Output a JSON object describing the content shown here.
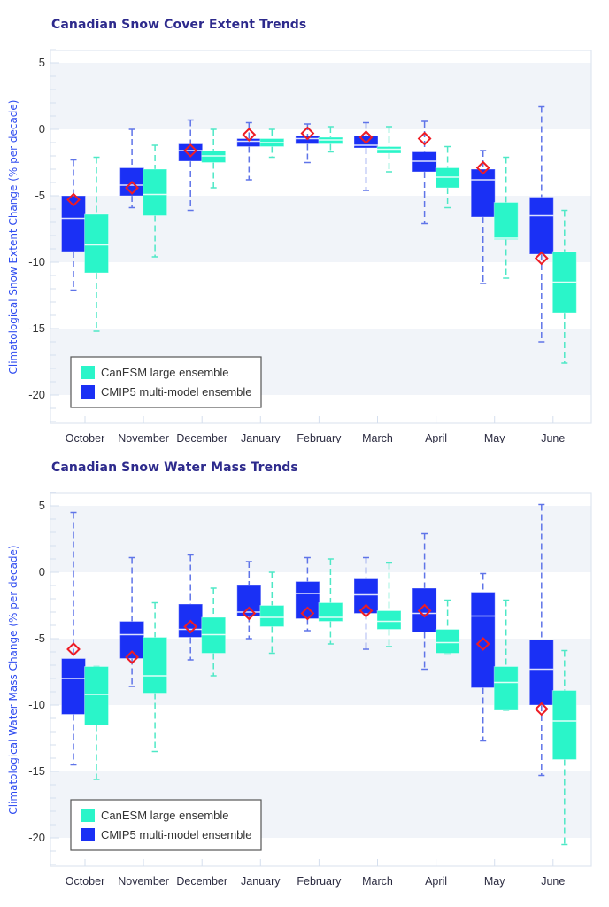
{
  "colors": {
    "cmip5": "#1a30f5",
    "canesm": "#2af5c9",
    "cmip5_whisker": "#5f74e8",
    "canesm_whisker": "#4ee8c6",
    "observed_marker": "#ee1c25",
    "title": "#2d2a8c",
    "ylabel": "#2f4cf0",
    "band": "#f1f4f9"
  },
  "chart_data": [
    {
      "type": "box",
      "title": "Canadian Snow Cover Extent Trends",
      "xlabel": "",
      "ylabel": "Climatological Snow Extent Change (% per decade)",
      "ylim": [
        -22,
        6
      ],
      "yticks": [
        5,
        0,
        -5,
        -10,
        -15,
        -20
      ],
      "ytick_labels": [
        "5",
        "0",
        "-5",
        "-10",
        "-15",
        "-20"
      ],
      "categories": [
        "October",
        "November",
        "December",
        "January",
        "February",
        "March",
        "April",
        "May",
        "June"
      ],
      "legend": {
        "position": "bottom-left",
        "entries": [
          "CanESM large ensemble",
          "CMIP5 multi-model ensemble"
        ]
      },
      "series": [
        {
          "name": "CMIP5 multi-model ensemble",
          "key": "cmip5",
          "boxes": [
            {
              "whisker_high": -2.3,
              "q3": -5.0,
              "median": -6.7,
              "q1": -9.2,
              "whisker_low": -12.1
            },
            {
              "whisker_high": 0.0,
              "q3": -2.9,
              "median": -4.2,
              "q1": -5.0,
              "whisker_low": -5.9
            },
            {
              "whisker_high": 0.7,
              "q3": -1.1,
              "median": -1.6,
              "q1": -2.4,
              "whisker_low": -6.1
            },
            {
              "whisker_high": 0.5,
              "q3": -0.7,
              "median": -0.9,
              "q1": -1.3,
              "whisker_low": -3.8
            },
            {
              "whisker_high": 0.4,
              "q3": -0.5,
              "median": -0.7,
              "q1": -1.1,
              "whisker_low": -2.5
            },
            {
              "whisker_high": 0.5,
              "q3": -0.5,
              "median": -1.2,
              "q1": -1.4,
              "whisker_low": -4.6
            },
            {
              "whisker_high": 0.6,
              "q3": -1.7,
              "median": -2.4,
              "q1": -3.2,
              "whisker_low": -7.1
            },
            {
              "whisker_high": -1.6,
              "q3": -3.0,
              "median": -3.8,
              "q1": -6.6,
              "whisker_low": -11.6
            },
            {
              "whisker_high": 1.7,
              "q3": -5.1,
              "median": -6.5,
              "q1": -9.4,
              "whisker_low": -16.0
            }
          ]
        },
        {
          "name": "CanESM large ensemble",
          "key": "canesm",
          "boxes": [
            {
              "whisker_high": -2.1,
              "q3": -6.4,
              "median": -8.7,
              "q1": -10.8,
              "whisker_low": -15.2
            },
            {
              "whisker_high": -1.2,
              "q3": -3.0,
              "median": -4.9,
              "q1": -6.5,
              "whisker_low": -9.6
            },
            {
              "whisker_high": 0.0,
              "q3": -1.6,
              "median": -2.0,
              "q1": -2.5,
              "whisker_low": -4.4
            },
            {
              "whisker_high": 0.0,
              "q3": -0.7,
              "median": -1.0,
              "q1": -1.3,
              "whisker_low": -2.1
            },
            {
              "whisker_high": 0.2,
              "q3": -0.6,
              "median": -0.8,
              "q1": -1.1,
              "whisker_low": -1.7
            },
            {
              "whisker_high": 0.2,
              "q3": -1.3,
              "median": -1.5,
              "q1": -1.8,
              "whisker_low": -3.2
            },
            {
              "whisker_high": -1.3,
              "q3": -2.9,
              "median": -3.6,
              "q1": -4.4,
              "whisker_low": -5.9
            },
            {
              "whisker_high": -2.1,
              "q3": -5.5,
              "median": -8.2,
              "q1": -8.3,
              "whisker_low": -11.2
            },
            {
              "whisker_high": -6.1,
              "q3": -9.2,
              "median": -11.5,
              "q1": -13.8,
              "whisker_low": -17.6
            }
          ]
        }
      ],
      "observed": [
        -5.3,
        -4.4,
        -1.6,
        -0.4,
        -0.3,
        -0.6,
        -0.7,
        -2.9,
        -9.7
      ]
    },
    {
      "type": "box",
      "title": "Canadian Snow Water Mass Trends",
      "xlabel": "",
      "ylabel": "Climatological Water Mass Change (% per decade)",
      "ylim": [
        -22,
        6
      ],
      "yticks": [
        5,
        0,
        -5,
        -10,
        -15,
        -20
      ],
      "ytick_labels": [
        "5",
        "0",
        "-5",
        "-10",
        "-15",
        "-20"
      ],
      "categories": [
        "October",
        "November",
        "December",
        "January",
        "February",
        "March",
        "April",
        "May",
        "June"
      ],
      "legend": {
        "position": "bottom-left",
        "entries": [
          "CanESM large ensemble",
          "CMIP5 multi-model ensemble"
        ]
      },
      "series": [
        {
          "name": "CMIP5 multi-model ensemble",
          "key": "cmip5",
          "boxes": [
            {
              "whisker_high": 4.5,
              "q3": -6.5,
              "median": -8.0,
              "q1": -10.7,
              "whisker_low": -14.5
            },
            {
              "whisker_high": 1.1,
              "q3": -3.7,
              "median": -4.7,
              "q1": -6.5,
              "whisker_low": -8.6
            },
            {
              "whisker_high": 1.3,
              "q3": -2.4,
              "median": -4.3,
              "q1": -4.9,
              "whisker_low": -6.6
            },
            {
              "whisker_high": 0.8,
              "q3": -1.0,
              "median": -3.0,
              "q1": -3.3,
              "whisker_low": -5.0
            },
            {
              "whisker_high": 1.1,
              "q3": -0.7,
              "median": -1.6,
              "q1": -3.5,
              "whisker_low": -4.4
            },
            {
              "whisker_high": 1.1,
              "q3": -0.5,
              "median": -1.7,
              "q1": -3.1,
              "whisker_low": -5.8
            },
            {
              "whisker_high": 2.9,
              "q3": -1.2,
              "median": -3.1,
              "q1": -4.5,
              "whisker_low": -7.3
            },
            {
              "whisker_high": -0.1,
              "q3": -1.5,
              "median": -3.3,
              "q1": -8.7,
              "whisker_low": -12.7
            },
            {
              "whisker_high": 5.1,
              "q3": -5.1,
              "median": -7.3,
              "q1": -10.0,
              "whisker_low": -15.3
            }
          ]
        },
        {
          "name": "CanESM large ensemble",
          "key": "canesm",
          "boxes": [
            {
              "whisker_high": -7.1,
              "q3": -7.1,
              "median": -9.2,
              "q1": -11.5,
              "whisker_low": -15.6
            },
            {
              "whisker_high": -2.3,
              "q3": -4.9,
              "median": -7.8,
              "q1": -9.1,
              "whisker_low": -13.5
            },
            {
              "whisker_high": -1.2,
              "q3": -3.4,
              "median": -4.7,
              "q1": -6.1,
              "whisker_low": -7.8
            },
            {
              "whisker_high": 0.0,
              "q3": -2.5,
              "median": -3.4,
              "q1": -4.1,
              "whisker_low": -6.1
            },
            {
              "whisker_high": 1.0,
              "q3": -2.3,
              "median": -3.4,
              "q1": -3.7,
              "whisker_low": -5.4
            },
            {
              "whisker_high": 0.7,
              "q3": -2.9,
              "median": -3.7,
              "q1": -4.3,
              "whisker_low": -5.6
            },
            {
              "whisker_high": -2.1,
              "q3": -4.3,
              "median": -5.3,
              "q1": -6.1,
              "whisker_low": -6.1
            },
            {
              "whisker_high": -2.1,
              "q3": -7.1,
              "median": -8.3,
              "q1": -10.4,
              "whisker_low": -10.4
            },
            {
              "whisker_high": -5.9,
              "q3": -8.9,
              "median": -11.2,
              "q1": -14.1,
              "whisker_low": -20.5
            }
          ]
        }
      ],
      "observed": [
        -5.8,
        -6.4,
        -4.1,
        -3.1,
        -3.1,
        -2.9,
        -2.9,
        -5.4,
        -10.3
      ]
    }
  ]
}
